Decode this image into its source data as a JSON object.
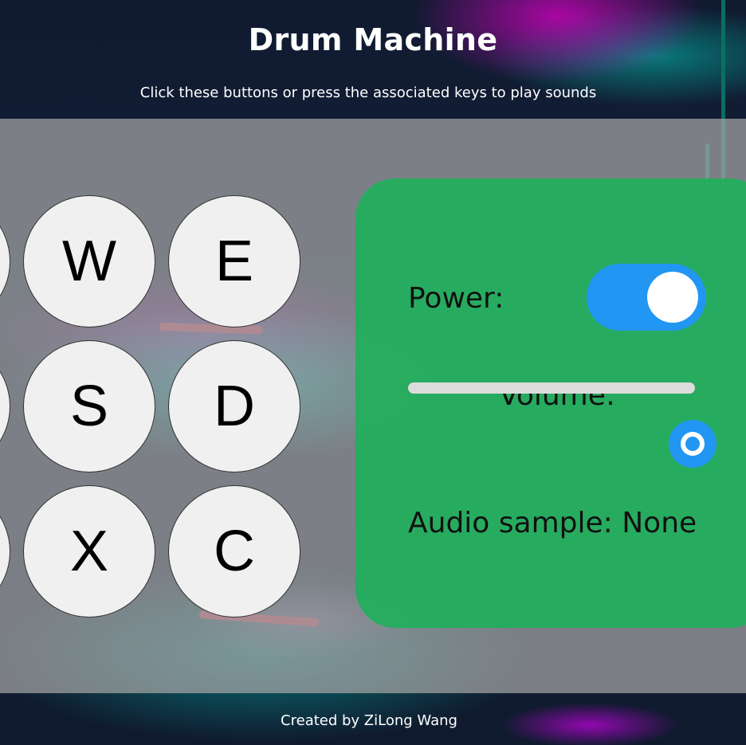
{
  "header": {
    "title": "Drum Machine",
    "subtitle": "Click these buttons or press the associated keys to play sounds"
  },
  "pads": [
    "W",
    "E",
    "S",
    "D",
    "X",
    "C"
  ],
  "controls": {
    "power_label": "Power:",
    "power_on": true,
    "volume_label": "Volume:",
    "volume_level": 1.0,
    "audio_label": "Audio sample:",
    "audio_value": "None"
  },
  "footer": {
    "credit": "Created by ZiLong Wang"
  },
  "colors": {
    "panel": "#20af5c",
    "accent": "#2196f3",
    "pad": "#f0f0f0"
  }
}
